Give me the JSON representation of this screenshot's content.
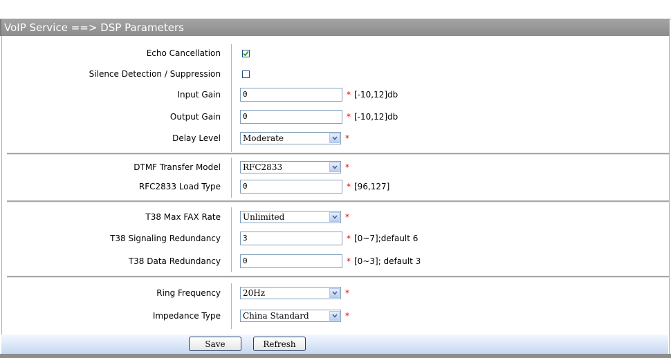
{
  "title": "VoIP Service ==> DSP Parameters",
  "fields": {
    "echo_cancellation": {
      "label": "Echo Cancellation",
      "checked": true
    },
    "silence_detection": {
      "label": "Silence Detection / Suppression",
      "checked": false
    },
    "input_gain": {
      "label": "Input Gain",
      "value": "0",
      "required": "*",
      "hint": "[-10,12]db"
    },
    "output_gain": {
      "label": "Output Gain",
      "value": "0",
      "required": "*",
      "hint": "[-10,12]db"
    },
    "delay_level": {
      "label": "Delay Level",
      "value": "Moderate",
      "required": "*"
    },
    "dtmf_transfer_model": {
      "label": "DTMF Transfer Model",
      "value": "RFC2833",
      "required": "*"
    },
    "rfc2833_load_type": {
      "label": "RFC2833 Load Type",
      "value": "0",
      "required": "*",
      "hint": "[96,127]"
    },
    "t38_max_fax_rate": {
      "label": "T38 Max FAX Rate",
      "value": "Unlimited",
      "required": "*"
    },
    "t38_signaling_redundancy": {
      "label": "T38 Signaling Redundancy",
      "value": "3",
      "required": "*",
      "hint": "[0~7];default 6"
    },
    "t38_data_redundancy": {
      "label": "T38 Data Redundancy",
      "value": "0",
      "required": "*",
      "hint": "[0~3]; default 3"
    },
    "ring_frequency": {
      "label": "Ring Frequency",
      "value": "20Hz",
      "required": "*"
    },
    "impedance_type": {
      "label": "Impedance Type",
      "value": "China Standard",
      "required": "*"
    }
  },
  "buttons": {
    "save": "Save",
    "refresh": "Refresh"
  },
  "colors": {
    "title_bar": "#999999",
    "required": "#e60000",
    "footer": "#c6d8f1"
  }
}
